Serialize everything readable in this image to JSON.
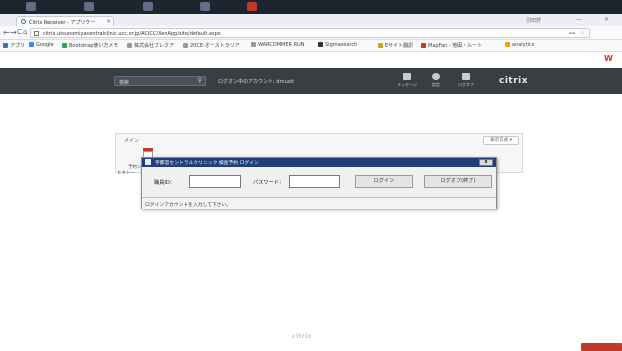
{
  "browser": {
    "tab_title": "Citrix Receiver - アプリケー",
    "tab_close": "×",
    "window_user": "羽田野",
    "window_minimize": "—",
    "window_close": "✕",
    "url": "citrix.utsunomiyacentralclinic.ucc.or.jp/ACICC/XenApp/site/default.aspx",
    "url_prefix": "ⓘ",
    "back": "←",
    "forward": "→",
    "reload": "C",
    "home": "⌂",
    "key_icon": "⊶",
    "star_icon": "☆",
    "ext_icon": "W",
    "bookmarks": [
      {
        "label": "アプリ",
        "color": "#3a6fc4"
      },
      {
        "label": "Google",
        "color": "#4285f4"
      },
      {
        "label": "Bootstrap使い方メモ",
        "color": "#2ea34a"
      },
      {
        "label": "株式会社ブレクア",
        "color": "#999999"
      },
      {
        "label": "20CE-オーストラリア",
        "color": "#999999"
      },
      {
        "label": "WARCOMMER RUN",
        "color": "#999999"
      },
      {
        "label": "Sigmasearch",
        "color": "#333333"
      },
      {
        "label": "Eサイト翻訳",
        "color": "#c9a227"
      },
      {
        "label": "MapFan - 地図・ルート",
        "color": "#d93025"
      },
      {
        "label": "analytics",
        "color": "#e8a020"
      }
    ]
  },
  "citrix": {
    "search_placeholder": "検索",
    "search_icon": "⚲",
    "user_label": "ログオン中のアカウント: drnuoit",
    "header_icons": [
      {
        "name": "messages-icon",
        "label": "メッセージ"
      },
      {
        "name": "settings-icon",
        "label": "設定"
      },
      {
        "name": "logoff-icon",
        "label": "ログオフ"
      }
    ],
    "logo": "citrix"
  },
  "main": {
    "panel_title": "メイン",
    "display_button": "表示方式 ▾",
    "app_label": "予約システム確認",
    "side_label": "ヒネトー"
  },
  "dialog": {
    "title": "宇都宮セントラルクリニック 検査予約 ログイン",
    "close": "x",
    "id_label": "職員ID：",
    "id_value": "",
    "password_label": "パスワード：",
    "password_value": "",
    "login_button": "ログイン",
    "logoff_button": "ログオフ(終了)",
    "status": "ログインアカウントを入力して下さい。"
  },
  "footer": {
    "logo": "citrix"
  }
}
